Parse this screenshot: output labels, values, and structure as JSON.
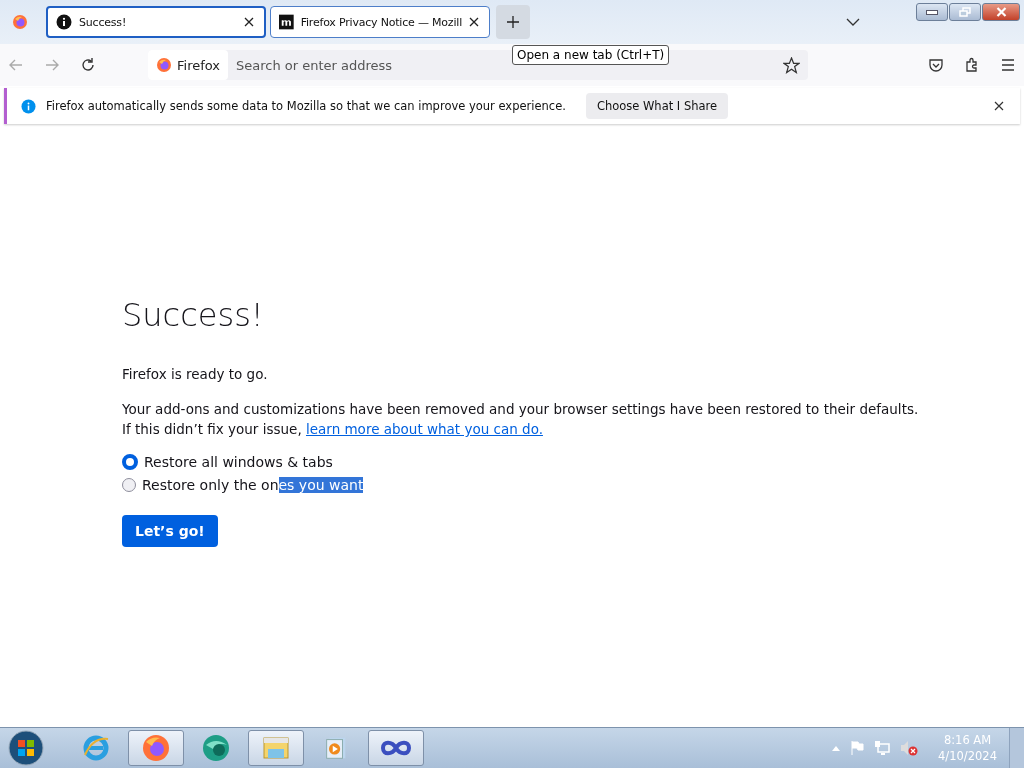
{
  "tabs": [
    {
      "title": "Success!",
      "selected": true
    },
    {
      "title": "Firefox Privacy Notice — Mozill",
      "selected": false
    }
  ],
  "tooltip": "Open a new tab (Ctrl+T)",
  "address_bar": {
    "identity": "Firefox",
    "placeholder": "Search or enter address"
  },
  "notification": {
    "message": "Firefox automatically sends some data to Mozilla so that we can improve your experience.",
    "button": "Choose What I Share"
  },
  "page": {
    "heading": "Success!",
    "intro": "Firefox is ready to go.",
    "body": "Your add-ons and customizations have been removed and your browser settings have been restored to their defaults.",
    "help_prefix": "If this didn’t fix your issue,",
    "help_link": "learn more about what you can do.",
    "options": [
      {
        "parts": [
          {
            "text": "Restore all windows & tabs",
            "highlighted": false
          }
        ],
        "selected": true
      },
      {
        "parts": [
          {
            "text": "Restore only the on",
            "highlighted": false
          },
          {
            "text": "es you want",
            "highlighted": true
          }
        ],
        "selected": false
      }
    ],
    "button": "Let’s go!"
  },
  "taskbar": {
    "items": [
      {
        "kind": "ie",
        "selected": false
      },
      {
        "kind": "firefox",
        "selected": true
      },
      {
        "kind": "globe",
        "selected": false
      },
      {
        "kind": "folder",
        "selected": true
      },
      {
        "kind": "media",
        "selected": false
      },
      {
        "kind": "infinity",
        "selected": true
      }
    ],
    "time": "8:16 AM",
    "date": "4/10/2024"
  }
}
